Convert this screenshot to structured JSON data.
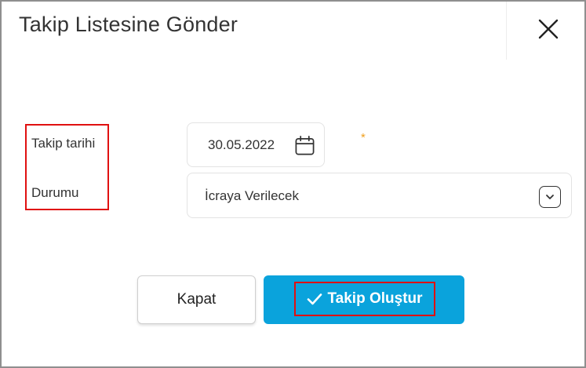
{
  "dialog": {
    "title": "Takip Listesine Gönder",
    "close_icon": "close-icon"
  },
  "form": {
    "date_label": "Takip tarihi",
    "date_value": "30.05.2022",
    "date_icon": "calendar-icon",
    "required_mark": "*",
    "status_label": "Durumu",
    "status_value": "İcraya Verilecek",
    "status_icon": "chevron-down-icon"
  },
  "actions": {
    "close_label": "Kapat",
    "create_label": "Takip Oluştur",
    "create_icon": "check-icon"
  },
  "colors": {
    "primary": "#0aa3dc",
    "highlight": "#e01010",
    "required": "#f0a020"
  }
}
